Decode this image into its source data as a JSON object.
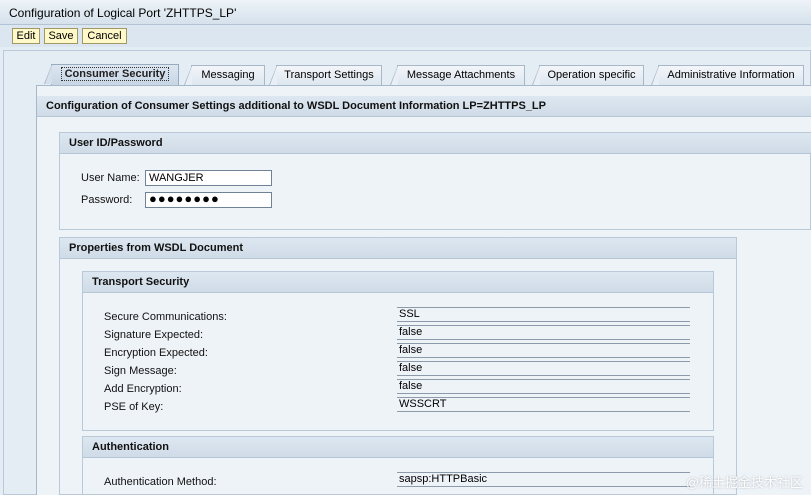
{
  "window": {
    "title": "Configuration of Logical Port 'ZHTTPS_LP'"
  },
  "toolbar": {
    "edit_label": "Edit",
    "save_label": "Save",
    "cancel_label": "Cancel"
  },
  "tabs": [
    {
      "label": "Consumer Security",
      "active": true
    },
    {
      "label": "Messaging",
      "active": false
    },
    {
      "label": "Transport Settings",
      "active": false
    },
    {
      "label": "Message Attachments",
      "active": false
    },
    {
      "label": "Operation specific",
      "active": false
    },
    {
      "label": "Administrative Information",
      "active": false
    }
  ],
  "panel": {
    "title": "Configuration of Consumer Settings additional to WSDL Document Information LP=ZHTTPS_LP"
  },
  "user_section": {
    "title": "User ID/Password",
    "username_label": "User Name:",
    "username_value": "WANGJER",
    "password_label": "Password:",
    "password_value": "●●●●●●●●"
  },
  "wsdl_section": {
    "title": "Properties from WSDL Document",
    "transport_security": {
      "title": "Transport Security",
      "rows": [
        {
          "label": "Secure Communications:",
          "value": "SSL"
        },
        {
          "label": "Signature Expected:",
          "value": "false"
        },
        {
          "label": "Encryption Expected:",
          "value": "false"
        },
        {
          "label": "Sign Message:",
          "value": "false"
        },
        {
          "label": "Add Encryption:",
          "value": "false"
        },
        {
          "label": "PSE of Key:",
          "value": "WSSCRT"
        }
      ]
    },
    "authentication": {
      "title": "Authentication",
      "method_label": "Authentication Method:",
      "method_value": "sapsp:HTTPBasic"
    }
  },
  "watermark": "@稀土掘金技术社区",
  "colors": {
    "button_bg": "#fff8c8",
    "header_bg": "#cfdbe7",
    "page_bg": "#e4ecf4"
  }
}
